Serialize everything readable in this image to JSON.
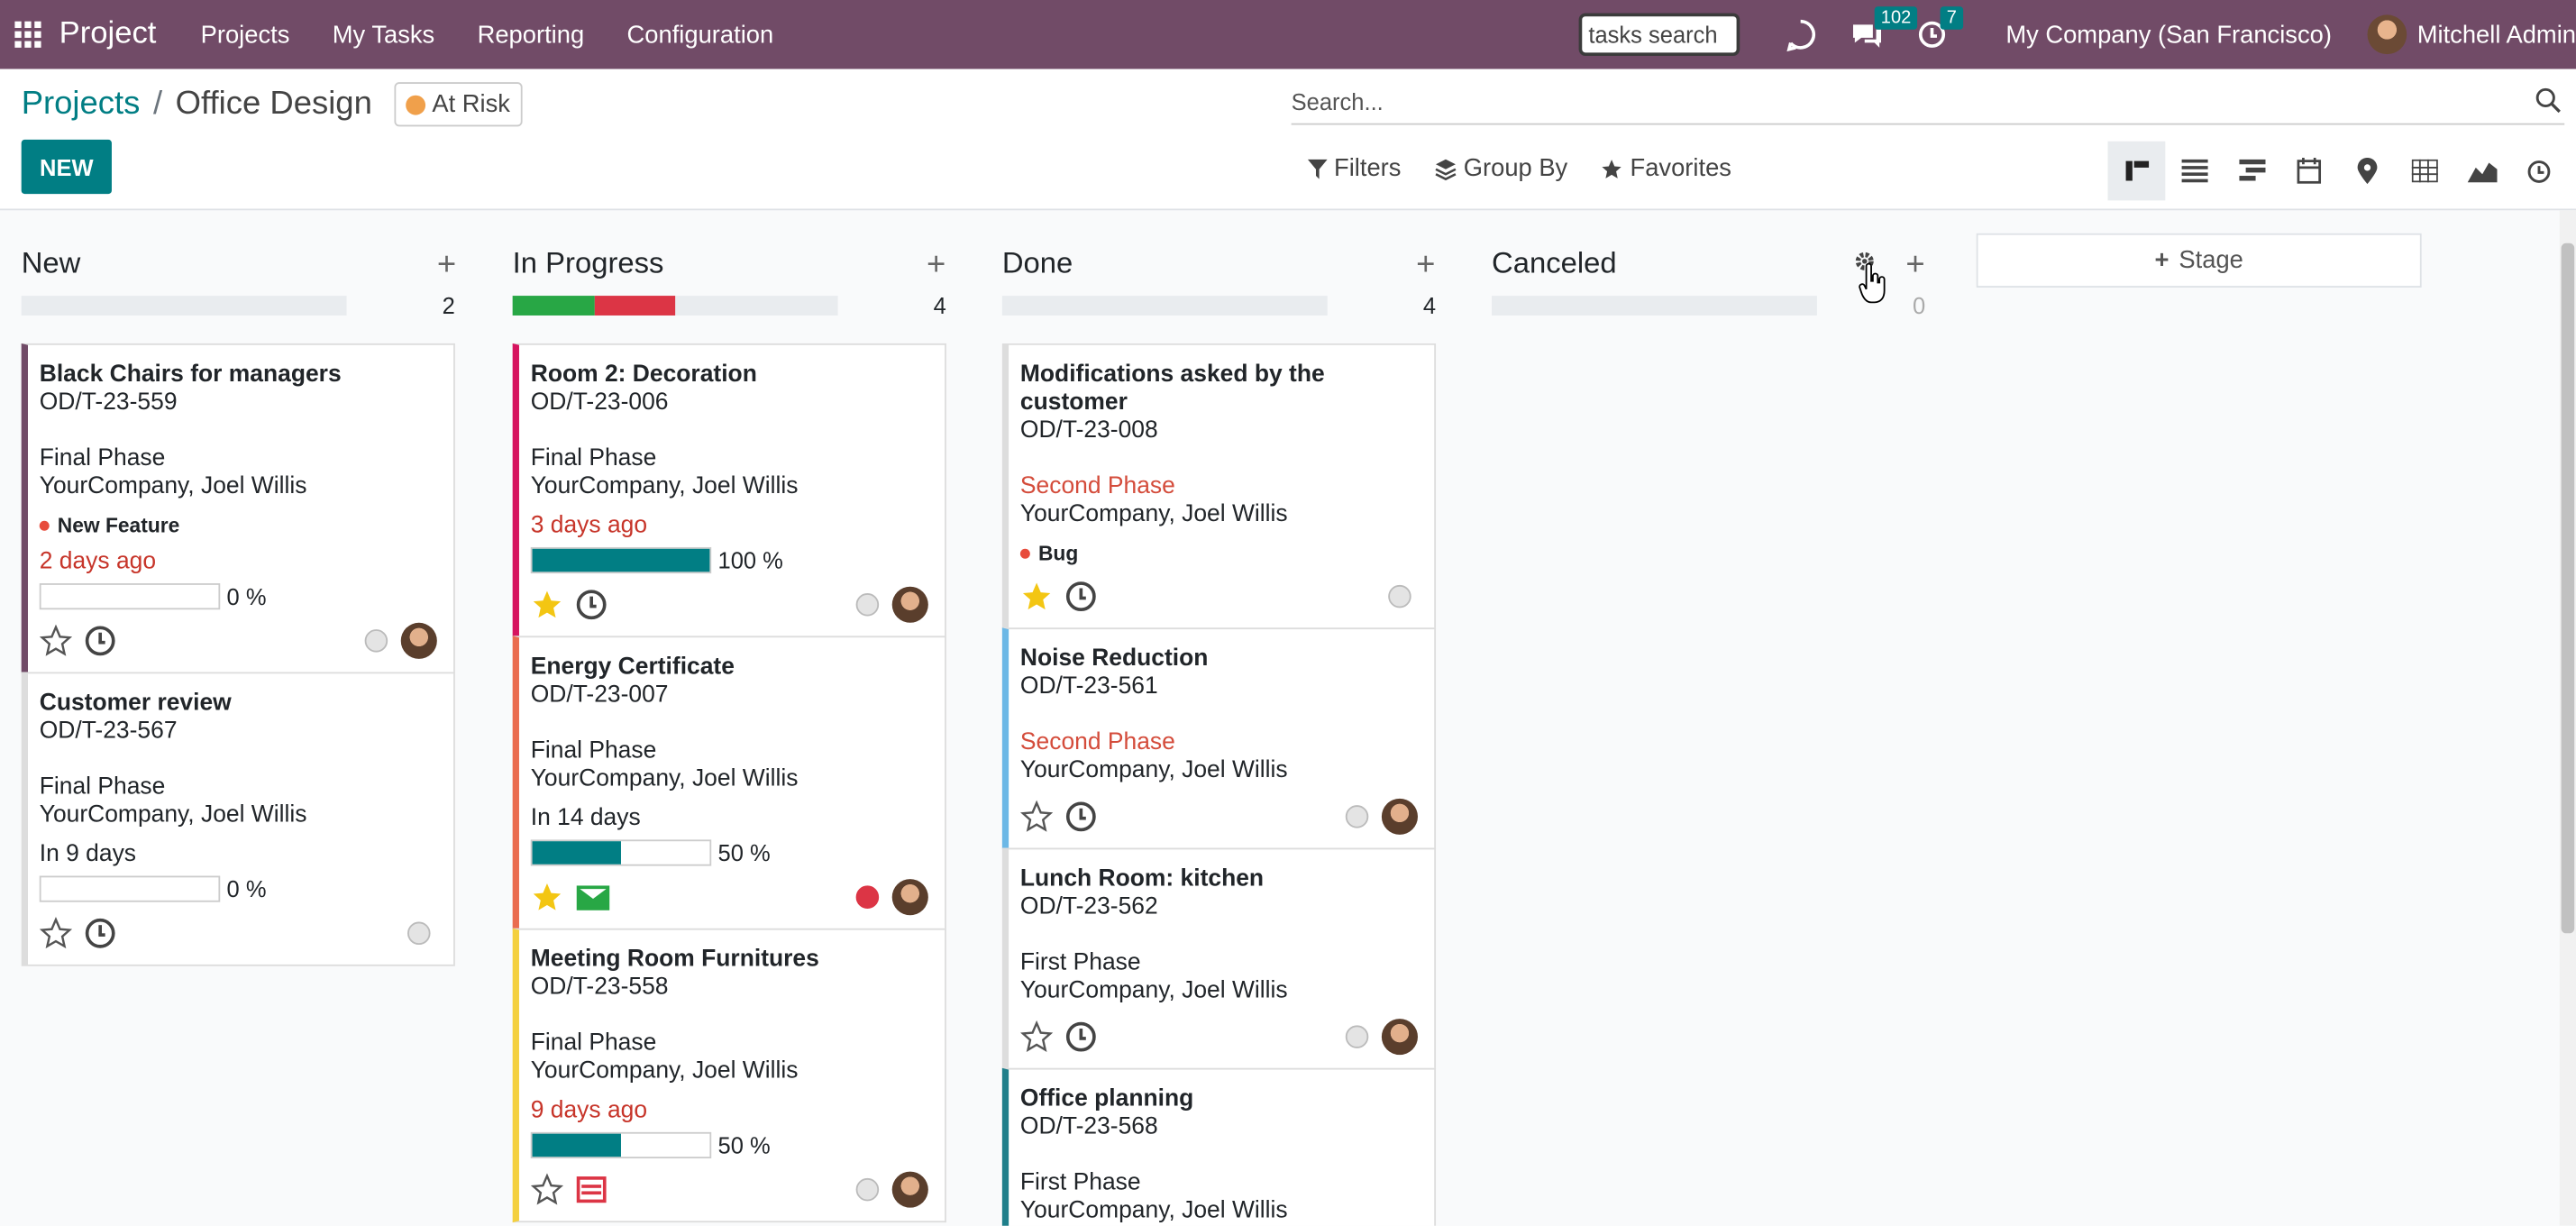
{
  "topbar": {
    "app_title": "Project",
    "menu": [
      "Projects",
      "My Tasks",
      "Reporting",
      "Configuration"
    ],
    "tasks_search": "tasks search",
    "messages_count": "102",
    "activities_count": "7",
    "company": "My Company (San Francisco)",
    "user": "Mitchell Admin"
  },
  "breadcrumb": {
    "parent": "Projects",
    "separator": "/",
    "current": "Office Design"
  },
  "status": {
    "label": "At Risk",
    "color": "#f0a04b"
  },
  "new_button": "NEW",
  "search": {
    "placeholder": "Search..."
  },
  "filters": {
    "filters": "Filters",
    "group_by": "Group By",
    "favorites": "Favorites"
  },
  "views": [
    "kanban-icon",
    "list-icon",
    "gantt-icon",
    "calendar-icon",
    "map-icon",
    "pivot-icon",
    "graph-icon",
    "activity-icon"
  ],
  "columns": [
    {
      "name": "New",
      "count": "2",
      "cards": [
        {
          "title": "Black Chairs for managers",
          "ref": "OD/T-23-559",
          "phase": "Final Phase",
          "owner": "YourCompany, Joel Willis",
          "tag": "New Feature",
          "date": "2 days ago",
          "progress": "0 %"
        },
        {
          "title": "Customer review",
          "ref": "OD/T-23-567",
          "phase": "Final Phase",
          "owner": "YourCompany, Joel Willis",
          "date": "In 9 days",
          "progress": "0 %"
        }
      ]
    },
    {
      "name": "In Progress",
      "count": "4",
      "cards": [
        {
          "title": "Room 2: Decoration",
          "ref": "OD/T-23-006",
          "phase": "Final Phase",
          "owner": "YourCompany, Joel Willis",
          "date": "3 days ago",
          "progress": "100 %"
        },
        {
          "title": "Energy Certificate",
          "ref": "OD/T-23-007",
          "phase": "Final Phase",
          "owner": "YourCompany, Joel Willis",
          "date": "In 14 days",
          "progress": "50 %"
        },
        {
          "title": "Meeting Room Furnitures",
          "ref": "OD/T-23-558",
          "phase": "Final Phase",
          "owner": "YourCompany, Joel Willis",
          "date": "9 days ago",
          "progress": "50 %"
        }
      ]
    },
    {
      "name": "Done",
      "count": "4",
      "cards": [
        {
          "title": "Modifications asked by the customer",
          "ref": "OD/T-23-008",
          "phase": "Second Phase",
          "owner": "YourCompany, Joel Willis",
          "tag": "Bug"
        },
        {
          "title": "Noise Reduction",
          "ref": "OD/T-23-561",
          "phase": "Second Phase",
          "owner": "YourCompany, Joel Willis"
        },
        {
          "title": "Lunch Room: kitchen",
          "ref": "OD/T-23-562",
          "phase": "First Phase",
          "owner": "YourCompany, Joel Willis"
        },
        {
          "title": "Office planning",
          "ref": "OD/T-23-568",
          "phase": "First Phase",
          "owner": "YourCompany, Joel Willis"
        }
      ]
    },
    {
      "name": "Canceled",
      "count": "0",
      "cards": []
    }
  ],
  "progress_values": {
    "in_progress_green": 0.25,
    "in_progress_red": 0.25,
    "card_room2": 1.0,
    "card_energy": 0.5,
    "card_meeting": 0.5,
    "card_black_chairs": 0,
    "card_customer_review": 0
  },
  "add_stage": "Stage",
  "colors": {
    "brand": "#714b67",
    "accent": "#017e84",
    "danger": "#dc3545",
    "success": "#28a745",
    "warning": "#f0a04b"
  }
}
